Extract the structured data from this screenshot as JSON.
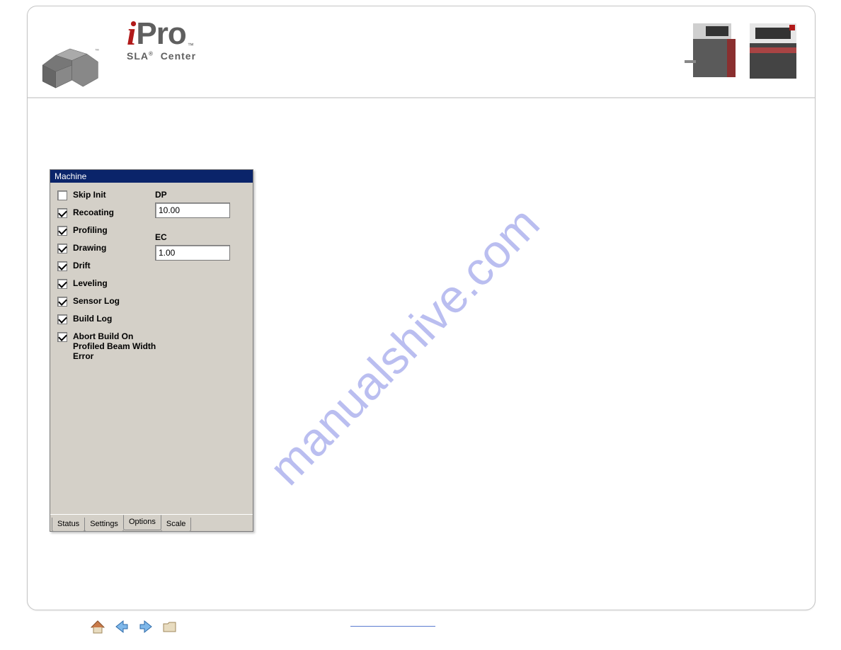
{
  "brand": {
    "i": "i",
    "pro": "Pro",
    "tm": "™",
    "line2_a": "SLA",
    "line2_reg": "®",
    "line2_b": "Center"
  },
  "watermark": "manualshive.com",
  "panel": {
    "title": "Machine",
    "checks": [
      {
        "label": "Skip Init",
        "checked": false
      },
      {
        "label": "Recoating",
        "checked": true
      },
      {
        "label": "Profiling",
        "checked": true
      },
      {
        "label": "Drawing",
        "checked": true
      },
      {
        "label": "Drift",
        "checked": true
      },
      {
        "label": "Leveling",
        "checked": true
      },
      {
        "label": "Sensor Log",
        "checked": true
      },
      {
        "label": "Build Log",
        "checked": true
      },
      {
        "label": "Abort Build On Profiled Beam Width Error",
        "checked": true
      }
    ],
    "fields": {
      "dp_label": "DP",
      "dp_value": "10.00",
      "ec_label": "EC",
      "ec_value": "1.00"
    },
    "tabs": [
      {
        "label": "Status",
        "active": false
      },
      {
        "label": "Settings",
        "active": false
      },
      {
        "label": "Options",
        "active": true
      },
      {
        "label": "Scale",
        "active": false
      }
    ]
  }
}
